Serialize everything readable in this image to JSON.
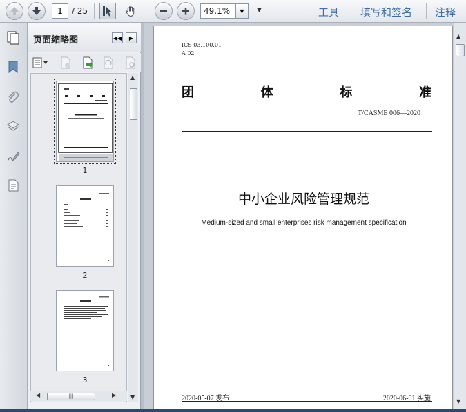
{
  "toolbar": {
    "current_page": "1",
    "total_pages": "/ 25",
    "zoom": "49.1%",
    "menu_arrow": "▼",
    "right_links": [
      "工具",
      "填写和签名",
      "注释"
    ]
  },
  "side_panel": {
    "title": "页面缩略图",
    "thumbnails": [
      {
        "number": "1"
      },
      {
        "number": "2"
      },
      {
        "number": "3"
      }
    ]
  },
  "document": {
    "ics": "ICS 03.100.01",
    "classification": "A 02",
    "standard_title_chars": [
      "团",
      "体",
      "标",
      "准"
    ],
    "standard_number": "T/CASME 006—2020",
    "title_cn": "中小企业风险管理规范",
    "title_en": "Medium-sized and small enterprises risk management specification",
    "publish_date": "2020-05-07 发布",
    "implement_date": "2020-06-01 实施"
  },
  "colors": {
    "accent_link": "#3f6ea4",
    "toolbar_bg": "#e3e7ec",
    "workspace_bg": "#c9ced6"
  }
}
